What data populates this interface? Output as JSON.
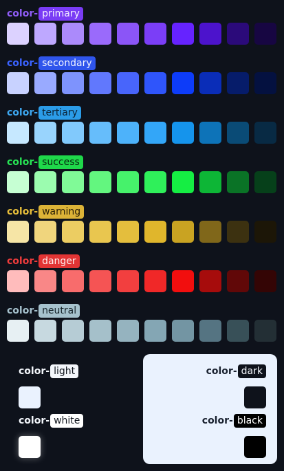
{
  "prefix": "color-",
  "palettes": [
    {
      "name": "primary",
      "prefix_color": "#8f5cf6",
      "chip_bg": "#7a3cf5",
      "chip_fg": "#f3efff",
      "swatches": [
        "#dcd2ff",
        "#bea8ff",
        "#ab8afb",
        "#9a6afb",
        "#8b55f7",
        "#7b3ef7",
        "#6623ff",
        "#4c13cc",
        "#2b0a7a",
        "#170642"
      ]
    },
    {
      "name": "secondary",
      "prefix_color": "#3a62ff",
      "chip_bg": "#2f55ec",
      "chip_fg": "#eef2ff",
      "swatches": [
        "#c8d2ff",
        "#99aaff",
        "#7e93fd",
        "#6178fd",
        "#4865fb",
        "#2f55fb",
        "#0d3cf9",
        "#0a2db8",
        "#061c6a",
        "#041140"
      ]
    },
    {
      "name": "tertiary",
      "prefix_color": "#3da7f0",
      "chip_bg": "#2b9ce8",
      "chip_fg": "#0b2236",
      "swatches": [
        "#c6e8ff",
        "#99d4fd",
        "#81c9fc",
        "#66bdfb",
        "#4db2fa",
        "#33a6f8",
        "#1594ec",
        "#0d73b8",
        "#0a4b76",
        "#082a44"
      ]
    },
    {
      "name": "success",
      "prefix_color": "#27e354",
      "chip_bg": "#1fd84a",
      "chip_fg": "#06280f",
      "swatches": [
        "#c6ffd3",
        "#9bfcaf",
        "#80fa97",
        "#63f67f",
        "#46f26b",
        "#2ff05a",
        "#15ee43",
        "#0db636",
        "#0a7326",
        "#06401a"
      ]
    },
    {
      "name": "warning",
      "prefix_color": "#e6bd3a",
      "chip_bg": "#dcb337",
      "chip_fg": "#2a2006",
      "swatches": [
        "#f6e5a6",
        "#f0d57d",
        "#eccd62",
        "#e9c64f",
        "#e4be3d",
        "#e0b62c",
        "#c9a322",
        "#80671a",
        "#3c3110",
        "#1c1607"
      ]
    },
    {
      "name": "danger",
      "prefix_color": "#ef3c3c",
      "chip_bg": "#e23434",
      "chip_fg": "#fff0f0",
      "swatches": [
        "#ffbcbc",
        "#f98787",
        "#f86c6c",
        "#f55454",
        "#f23f3f",
        "#f02828",
        "#f20e0e",
        "#a60c0c",
        "#610808",
        "#340505"
      ]
    },
    {
      "name": "neutral",
      "prefix_color": "#a5c0cc",
      "chip_bg": "#a6c2cd",
      "chip_fg": "#17252b",
      "swatches": [
        "#e7f0f3",
        "#c7d9e0",
        "#b6ccd5",
        "#a5c0ca",
        "#95b3bf",
        "#84a6b4",
        "#7395a3",
        "#557482",
        "#385058",
        "#232f35"
      ]
    }
  ],
  "basics": {
    "light": {
      "name": "light",
      "color": "#eaf2fe",
      "text_color": "#f3f6fb",
      "chip_bg": "#f3f6fb",
      "chip_fg": "#10151d"
    },
    "white": {
      "name": "white",
      "color": "#ffffff",
      "text_color": "#f3f6fb",
      "chip_bg": "#ffffff",
      "chip_fg": "#10151d"
    },
    "dark": {
      "name": "dark",
      "color": "#0e121b",
      "text_color": "#1a2230",
      "chip_bg": "#0e121b",
      "chip_fg": "#f3f6fb"
    },
    "black": {
      "name": "black",
      "color": "#000000",
      "text_color": "#1a2230",
      "chip_bg": "#000000",
      "chip_fg": "#ffffff"
    }
  }
}
